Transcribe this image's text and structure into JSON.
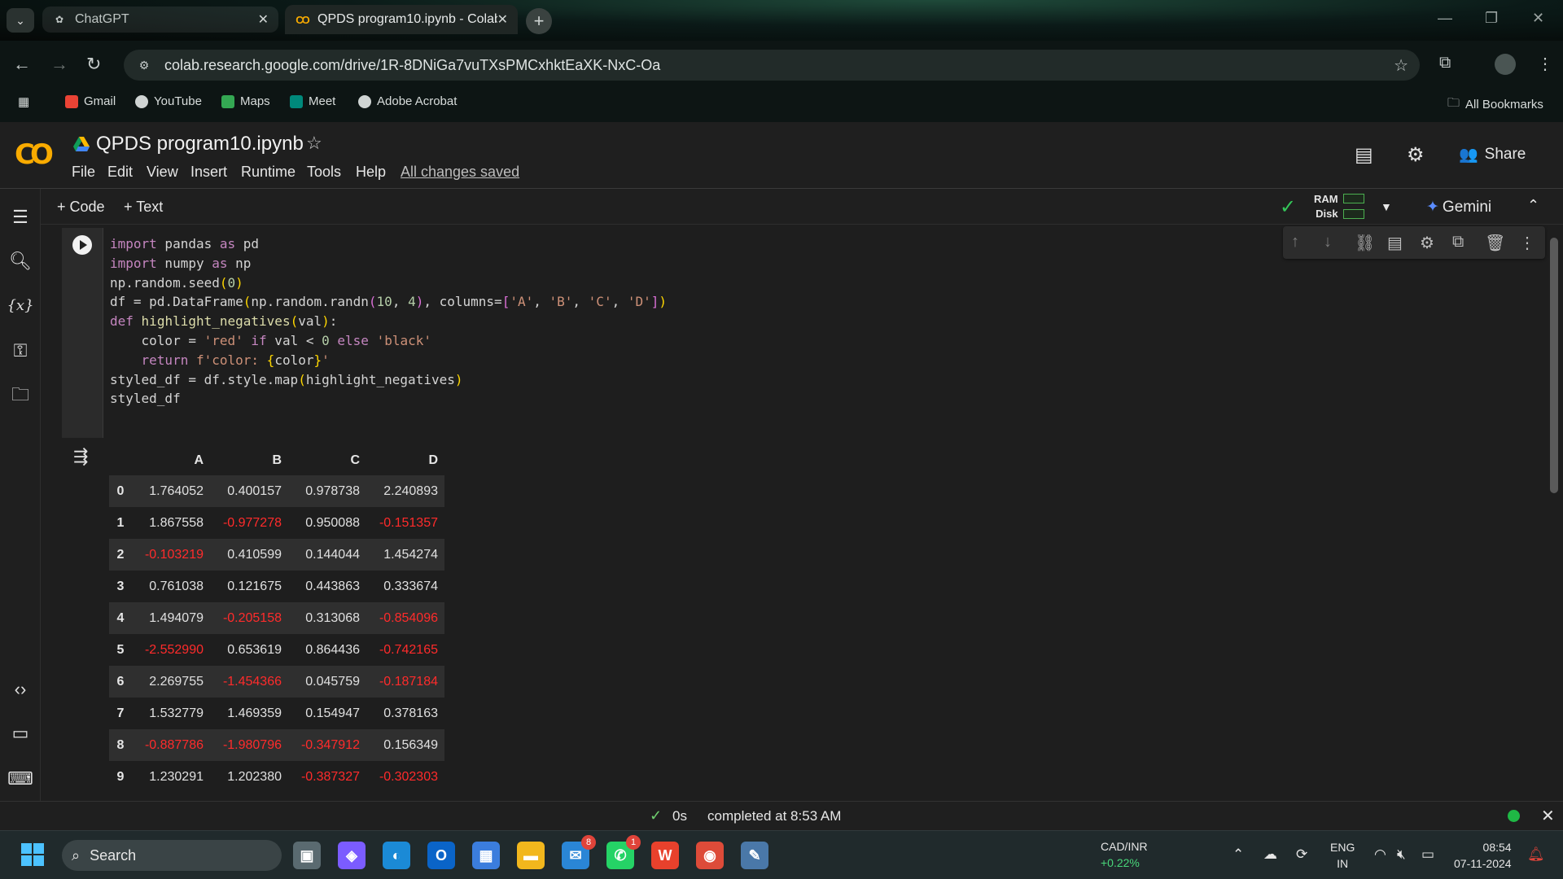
{
  "browser": {
    "tabs": [
      {
        "label": "ChatGPT",
        "icon": "chatgpt-icon",
        "active": false
      },
      {
        "label": "QPDS program10.ipynb - Colab",
        "icon": "colab-icon",
        "active": true
      }
    ],
    "url": "colab.research.google.com/drive/1R-8DNiGa7vuTXsPMCxhktEaXK-NxC-Oa",
    "bookmarks": [
      {
        "label": "Gmail",
        "color": "#ea4335"
      },
      {
        "label": "YouTube",
        "color": "#ff0000"
      },
      {
        "label": "Maps",
        "color": "#34a853"
      },
      {
        "label": "Meet",
        "color": "#00897b"
      },
      {
        "label": "Adobe Acrobat",
        "color": "#b30b00"
      }
    ],
    "all_bookmarks": "All Bookmarks"
  },
  "colab": {
    "logo": "CO",
    "title": "QPDS program10.ipynb",
    "menu": [
      "File",
      "Edit",
      "View",
      "Insert",
      "Runtime",
      "Tools",
      "Help"
    ],
    "save_status": "All changes saved",
    "share_label": "Share",
    "toolbar": {
      "code_label": "+ Code",
      "text_label": "+ Text",
      "ram_label": "RAM",
      "disk_label": "Disk",
      "gemini_label": "Gemini"
    }
  },
  "cell": {
    "code_lines": [
      "import pandas as pd",
      "import numpy as np",
      "np.random.seed(0)",
      "df = pd.DataFrame(np.random.randn(10, 4), columns=['A', 'B', 'C', 'D'])",
      "def highlight_negatives(val):",
      "    color = 'red' if val < 0 else 'black'",
      "    return f'color: {color}'",
      "styled_df = df.style.map(highlight_negatives)",
      "styled_df"
    ]
  },
  "output_table": {
    "columns": [
      "A",
      "B",
      "C",
      "D"
    ],
    "rows": [
      {
        "index": "0",
        "values": [
          "1.764052",
          "0.400157",
          "0.978738",
          "2.240893"
        ]
      },
      {
        "index": "1",
        "values": [
          "1.867558",
          "-0.977278",
          "0.950088",
          "-0.151357"
        ]
      },
      {
        "index": "2",
        "values": [
          "-0.103219",
          "0.410599",
          "0.144044",
          "1.454274"
        ]
      },
      {
        "index": "3",
        "values": [
          "0.761038",
          "0.121675",
          "0.443863",
          "0.333674"
        ]
      },
      {
        "index": "4",
        "values": [
          "1.494079",
          "-0.205158",
          "0.313068",
          "-0.854096"
        ]
      },
      {
        "index": "5",
        "values": [
          "-2.552990",
          "0.653619",
          "0.864436",
          "-0.742165"
        ]
      },
      {
        "index": "6",
        "values": [
          "2.269755",
          "-1.454366",
          "0.045759",
          "-0.187184"
        ]
      },
      {
        "index": "7",
        "values": [
          "1.532779",
          "1.469359",
          "0.154947",
          "0.378163"
        ]
      },
      {
        "index": "8",
        "values": [
          "-0.887786",
          "-1.980796",
          "-0.347912",
          "0.156349"
        ]
      },
      {
        "index": "9",
        "values": [
          "1.230291",
          "1.202380",
          "-0.387327",
          "-0.302303"
        ]
      }
    ],
    "negative_color": "#ff2b2b"
  },
  "status_bar": {
    "duration": "0s",
    "message": "completed at 8:53 AM"
  },
  "taskbar": {
    "search_label": "Search",
    "apps": [
      {
        "name": "task-view",
        "color": "#5a6a70"
      },
      {
        "name": "copilot",
        "color": "#7b5cff"
      },
      {
        "name": "edge",
        "color": "#1b8ad6"
      },
      {
        "name": "outlook",
        "color": "#0a64c8"
      },
      {
        "name": "store",
        "color": "#3b7ddd"
      },
      {
        "name": "file-explorer",
        "color": "#f2b71d"
      },
      {
        "name": "teams-mail",
        "color": "#2a86d6",
        "badge": "8"
      },
      {
        "name": "whatsapp",
        "color": "#25d366",
        "badge": "1"
      },
      {
        "name": "wps-office",
        "color": "#e8412c"
      },
      {
        "name": "chrome",
        "color": "#dd4b39"
      },
      {
        "name": "python",
        "color": "#4a78a8"
      }
    ],
    "ticker": {
      "pair": "CAD/INR",
      "change": "+0.22%"
    },
    "lang_top": "ENG",
    "lang_bottom": "IN",
    "time": "08:54",
    "date": "07-11-2024"
  }
}
